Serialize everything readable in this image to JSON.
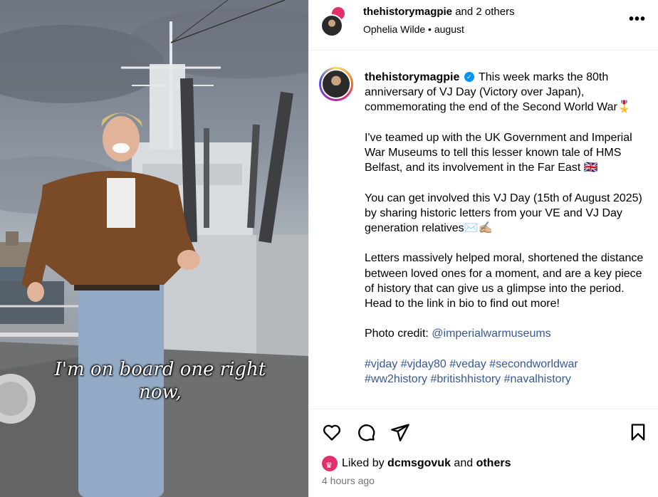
{
  "post": {
    "header": {
      "username": "thehistorymagpie",
      "collab_suffix": "and 2 others",
      "audio_credit": "Ophelia Wilde",
      "separator": "•",
      "date": "august",
      "more_icon": "more-horizontal-icon",
      "more_label": "•••"
    },
    "media": {
      "caption_line1": "I'm on board one right",
      "caption_line2": "now,"
    },
    "caption": {
      "username": "thehistorymagpie",
      "verified_icon": "verified-badge-icon",
      "p1": "This week marks the 80th anniversary of VJ Day (Victory over Japan), commemorating the end of the Second World War🎖️",
      "p2": "I've teamed up with the UK Government and Imperial War Museums to tell this lesser known tale of HMS Belfast, and its involvement in the Far East 🇬🇧",
      "p3": "You can get involved this VJ Day (15th of August 2025) by sharing historic letters from your VE and VJ Day generation relatives✉️✍🏼",
      "p4": "Letters massively helped moral, shortened the distance between loved ones for a moment, and are a key piece of history that can give us a glimpse into the period. Head to the link in bio to find out more!",
      "credit_label": "Photo credit: ",
      "credit_handle": "@imperialwarmuseums",
      "hashtags_line1": "#vjday #vjday80 #veday #secondworldwar",
      "hashtags_line2": "#ww2history #britishhistory #navalhistory"
    },
    "actions": {
      "like_icon": "heart-icon",
      "comment_icon": "comment-icon",
      "share_icon": "share-icon",
      "save_icon": "bookmark-icon"
    },
    "likes": {
      "prefix": "Liked by",
      "user": "dcmsgovuk",
      "conjunction": "and",
      "others": "others"
    },
    "timestamp": "4 hours ago"
  },
  "colors": {
    "link": "#385898",
    "verified": "#0095f6",
    "muted": "#737373",
    "divider": "#efefef"
  }
}
